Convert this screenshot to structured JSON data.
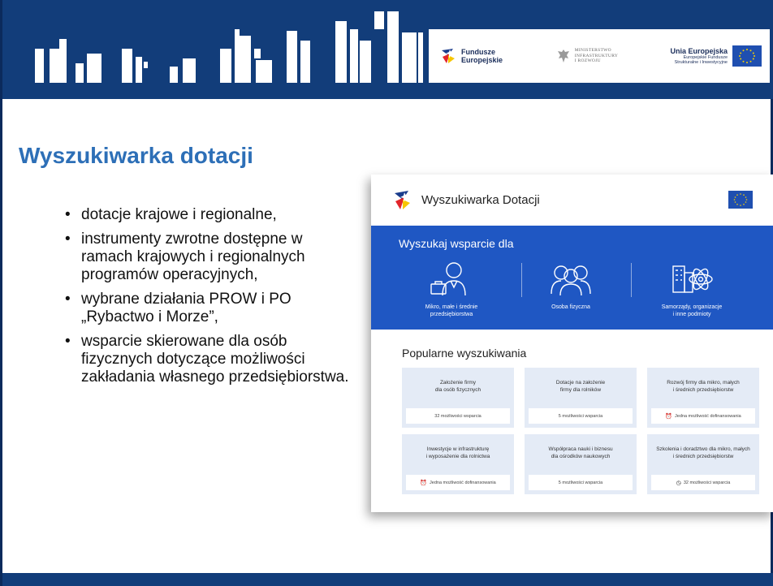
{
  "header": {
    "logos": {
      "fundusze": {
        "line1": "Fundusze",
        "line2": "Europejskie"
      },
      "ministerstwo": {
        "line1": "MINISTERSTWO",
        "line2": "INFRASTRUKTURY",
        "line3": "I ROZWOJU"
      },
      "unia": {
        "title": "Unia Europejska",
        "sub1": "Europejskie Fundusze",
        "sub2": "Strukturalne i Inwestycyjne"
      }
    },
    "colors": {
      "band": "#123d7a",
      "accent": "#2d6fb7"
    }
  },
  "slide": {
    "title": "Wyszukiwarka dotacji",
    "bullets": [
      "dotacje krajowe i regionalne,",
      "instrumenty zwrotne dostępne w ramach krajowych i regionalnych programów operacyjnych,",
      "wybrane działania PROW i PO „Rybactwo i Morze”,",
      "wsparcie skierowane dla osób fizycznych dotyczące możliwości zakładania własnego przedsiębiorstwa."
    ]
  },
  "screenshot": {
    "app_title": "Wyszukiwarka Dotacji",
    "eu_label": "UNIA EUROPEJSKA",
    "search_heading": "Wyszukaj wsparcie dla",
    "categories": [
      {
        "icon": "businessperson-icon",
        "line1": "Mikro, małe i średnie",
        "line2": "przedsiębiorstwa"
      },
      {
        "icon": "people-icon",
        "line1": "Osoba fizyczna",
        "line2": ""
      },
      {
        "icon": "city-atom-icon",
        "line1": "Samorządy, organizacje",
        "line2": "i inne podmioty"
      }
    ],
    "popular_heading": "Popularne wyszukiwania",
    "cards": [
      {
        "line1": "Założenie firmy",
        "line2": "dla osób fizycznych",
        "footer": "32 możliwości wsparcia",
        "icon": ""
      },
      {
        "line1": "Dotacje na założenie",
        "line2": "firmy dla rolników",
        "footer": "5 możliwości wsparcia",
        "icon": ""
      },
      {
        "line1": "Rozwój firmy dla mikro, małych",
        "line2": "i średnich przedsiębiorstw",
        "footer": "Jedna możliwość dofinansowania",
        "icon": "alarm-icon"
      },
      {
        "line1": "Inwestycje w infrastrukturę",
        "line2": "i wyposażenie dla rolnictwa",
        "footer": "Jedna możliwość dofinansowania",
        "icon": "alarm-icon"
      },
      {
        "line1": "Współpraca nauki i biznesu",
        "line2": "dla ośrodków naukowych",
        "footer": "5 możliwości wsparcia",
        "icon": ""
      },
      {
        "line1": "Szkolenia i doradztwo dla mikro, małych",
        "line2": "i średnich przedsiębiorstw",
        "footer": "32 możliwości wsparcia",
        "icon": "clock-icon"
      }
    ],
    "colors": {
      "blue": "#1f57c3",
      "card": "#e4ebf6"
    }
  }
}
